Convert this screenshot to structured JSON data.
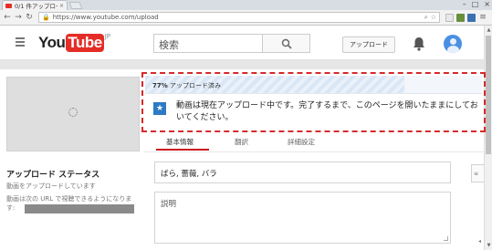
{
  "browser": {
    "tab_title": "0/1 件アップロード済み",
    "tab_close": "×",
    "url": "https://www.youtube.com/upload",
    "window_controls": [
      "–",
      "□",
      "×"
    ]
  },
  "header": {
    "logo_you": "You",
    "logo_tube": "Tube",
    "logo_region": "JP",
    "search_placeholder": "検索",
    "upload_label": "アップロード"
  },
  "upload": {
    "progress_percent": 77,
    "progress_bold": "77%",
    "progress_suffix": " アップロード済み",
    "status_message": "動画は現在アップロード中です。完了するまで、このページを開いたままにしておいてください。"
  },
  "tabs": [
    {
      "label": "基本情報"
    },
    {
      "label": "翻訳"
    },
    {
      "label": "詳細設定"
    }
  ],
  "sidebar": {
    "heading": "アップロード ステータス",
    "sub": "動画をアップロードしています",
    "url_label": "動画は次の URL で視聴できるようになります:"
  },
  "form": {
    "tags_value": "ばら, 薔薇, バラ",
    "description_placeholder": "説明"
  },
  "colors": {
    "brand_red": "#e52d27",
    "highlight_dashed": "#d62a2a",
    "info_blue": "#2d7ac4"
  }
}
